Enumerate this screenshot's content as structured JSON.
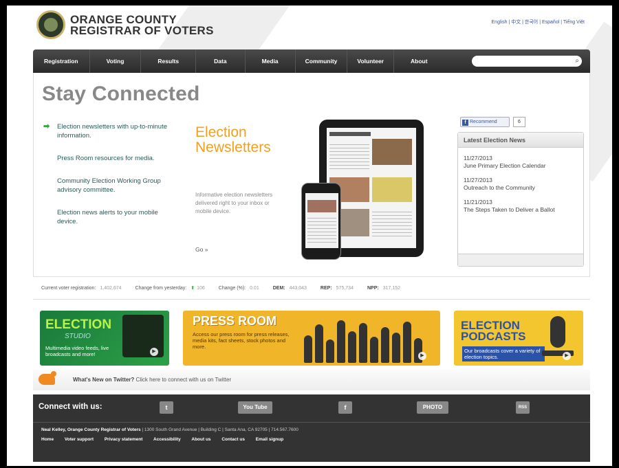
{
  "header": {
    "org_line1": "ORANGE COUNTY",
    "org_line2": "REGISTRAR OF VOTERS",
    "languages": [
      "English",
      "中文",
      "한국어",
      "Español",
      "Tiếng Việt"
    ]
  },
  "nav": {
    "items": [
      "Registration",
      "Voting",
      "Results",
      "Data",
      "Media",
      "Community",
      "Volunteer",
      "About"
    ],
    "search_placeholder": ""
  },
  "main": {
    "title": "Stay Connected",
    "bullets": [
      "Election newsletters with up-to-minute information.",
      "Press Room resources for media.",
      "Community Election Working Group advisory committee.",
      "Election news alerts to your mobile device."
    ],
    "feature": {
      "title_line1": "Election",
      "title_line2": "Newsletters",
      "description": "Informative election newsletters delivered right to your inbox or mobile device.",
      "link": "Go »"
    }
  },
  "sidebar": {
    "recommend_label": "Recommend",
    "recommend_count": "6",
    "news_heading": "Latest Election News",
    "news": [
      {
        "date": "11/27/2013",
        "title": "June Primary Election Calendar"
      },
      {
        "date": "11/27/2013",
        "title": "Outreach to the Community"
      },
      {
        "date": "11/21/2013",
        "title": "The Steps Taken to Deliver a Ballot"
      }
    ]
  },
  "stats": {
    "registration_label": "Current voter registration:",
    "registration_value": "1,402,674",
    "change_label": "Change from yesterday:",
    "change_value": "106",
    "change_pct_label": "Change (%):",
    "change_pct_value": "0.01",
    "dem_label": "DEM:",
    "dem_value": "443,043",
    "rep_label": "REP:",
    "rep_value": "575,734",
    "npp_label": "NPP:",
    "npp_value": "317,152"
  },
  "banners": {
    "studio": {
      "title_line1": "ELECTION",
      "title_line2": "STUDIO",
      "description": "Multimedia video feeds, live broadcasts and more!"
    },
    "press": {
      "title": "PRESS ROOM",
      "description": "Access our press room for press releases, media kits, fact sheets, stock photos and more."
    },
    "podcasts": {
      "title_line1": "ELECTION",
      "title_line2": "PODCASTS",
      "description": "Our broadcasts cover a variety of election topics."
    }
  },
  "twitter": {
    "lead": "What's New on Twitter?",
    "text": " Click here to connect with us on Twitter"
  },
  "footer": {
    "connect_label": "Connect with us:",
    "social": [
      "Twitter",
      "YouTube",
      "Facebook",
      "PHOTO",
      "RSS"
    ],
    "social_glyphs": {
      "twitter": "t",
      "youtube": "You Tube",
      "facebook": "f",
      "photo": "PHOTO",
      "rss": "RSS"
    },
    "registrar": "Neal Kelley, Orange County Registrar of Voters",
    "address": " | 1300 South Grand Avenue | Building C | Santa Ana, CA 92705 | 714.567.7600",
    "links": [
      "Home",
      "Voter support",
      "Privacy statement",
      "Accessibility",
      "About us",
      "Contact us",
      "Email signup"
    ]
  },
  "colors": {
    "nav_bg": "#333333",
    "accent_orange": "#f0a020",
    "link_teal": "#2b5a5a",
    "footer_bg": "#333333"
  }
}
